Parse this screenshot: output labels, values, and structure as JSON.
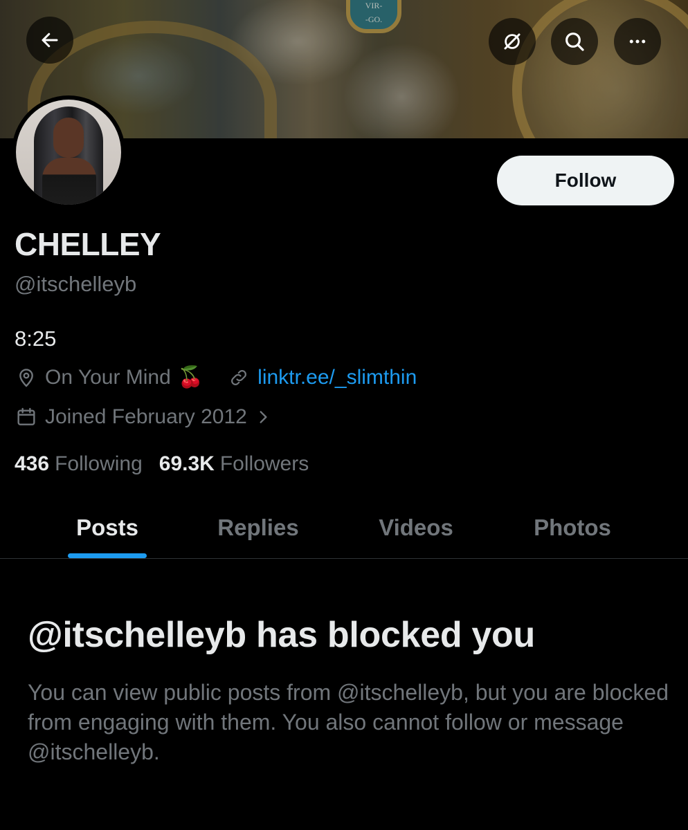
{
  "banner": {
    "plaque_text": "VIR-\n-GO."
  },
  "header": {
    "back_icon": "arrow-left-icon",
    "grok_icon": "grok-icon",
    "search_icon": "search-icon",
    "more_icon": "more-horizontal-icon"
  },
  "profile": {
    "display_name": "CHELLEY",
    "handle": "@itschelleyb",
    "bio": "8:25",
    "location": "On Your Mind",
    "location_emoji": "🍒",
    "website": "linktr.ee/_slimthin",
    "joined": "Joined February 2012",
    "follow_label": "Follow"
  },
  "stats": {
    "following_count": "436",
    "following_label": "Following",
    "followers_count": "69.3K",
    "followers_label": "Followers"
  },
  "tabs": [
    {
      "label": "Posts",
      "active": true
    },
    {
      "label": "Replies",
      "active": false
    },
    {
      "label": "Videos",
      "active": false
    },
    {
      "label": "Photos",
      "active": false
    }
  ],
  "blocked": {
    "title": "@itschelleyb has blocked you",
    "message": "You can view public posts from @itschelleyb, but you are blocked from engaging with them. You also cannot follow or message @itschelleyb."
  },
  "colors": {
    "background": "#000000",
    "text_primary": "#e7e9ea",
    "text_secondary": "#71767b",
    "accent": "#1d9bf0",
    "follow_bg": "#eff3f4"
  }
}
